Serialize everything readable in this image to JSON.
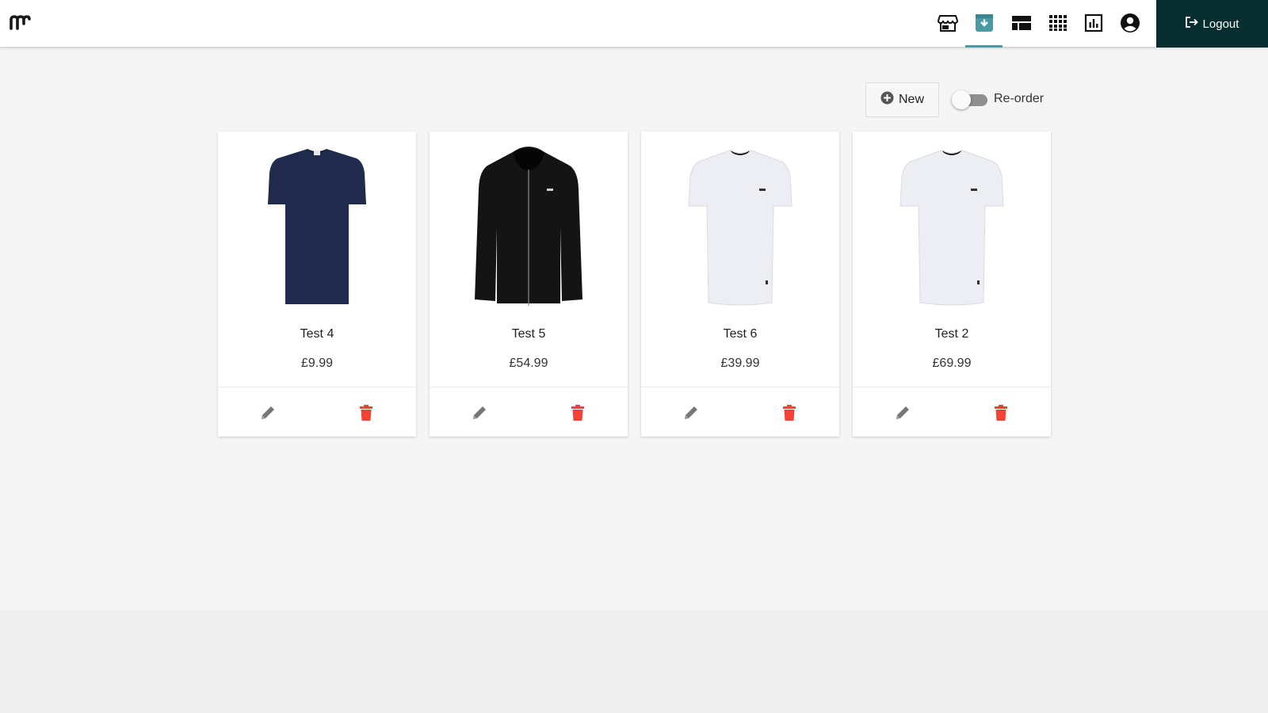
{
  "header": {
    "logo_icon": "logo-mark",
    "nav_icons": [
      "storefront-icon",
      "archive-icon",
      "web-layout-icon",
      "grid-icon",
      "bar-chart-icon",
      "account-circle-icon"
    ],
    "active_nav": "archive-icon",
    "logout_label": "Logout",
    "accent_color": "#4a9aa6",
    "logout_bg": "#062d2f"
  },
  "toolbar": {
    "new_label": "New",
    "reorder_label": "Re-order",
    "reorder_enabled": false
  },
  "products": [
    {
      "name": "Test 4",
      "price": "£9.99",
      "image": "navy-tshirt"
    },
    {
      "name": "Test 5",
      "price": "£54.99",
      "image": "black-zip-hoodie"
    },
    {
      "name": "Test 6",
      "price": "£39.99",
      "image": "white-tshirt"
    },
    {
      "name": "Test 2",
      "price": "£69.99",
      "image": "white-tshirt"
    }
  ],
  "card_actions": {
    "edit_icon": "pencil-icon",
    "delete_icon": "trash-icon",
    "delete_color": "#f44336"
  }
}
